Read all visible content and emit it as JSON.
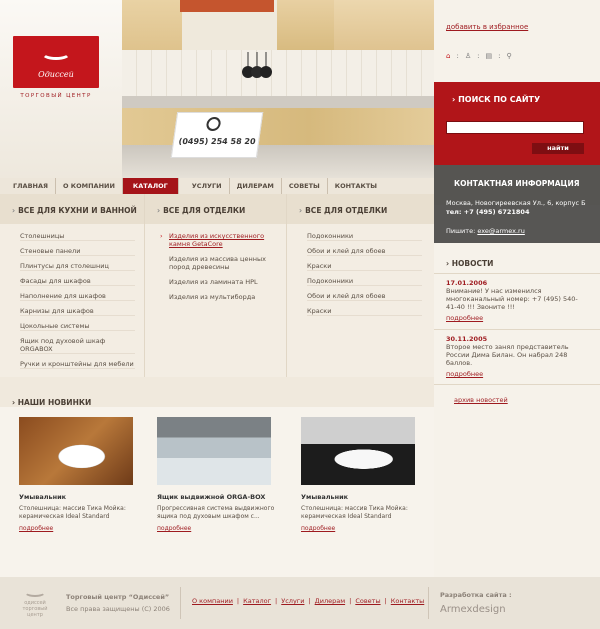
{
  "brand": {
    "name": "Одиссей",
    "tagline": "ТОРГОВЫЙ ЦЕНТР"
  },
  "phone": "(0495) 254 58 20",
  "favorites_link": "добавить в избранное",
  "top_icons": [
    "home-icon",
    "sitemap-icon",
    "bookmark-icon",
    "search-icon"
  ],
  "search": {
    "title": "ПОИСК ПО САЙТУ",
    "button": "найти",
    "placeholder": ""
  },
  "nav": [
    "ГЛАВНАЯ",
    "О КОМПАНИИ",
    "КАТАЛОГ",
    "УСЛУГИ",
    "ДИЛЕРАМ",
    "СОВЕТЫ",
    "КОНТАКТЫ"
  ],
  "nav_active": "КАТАЛОГ",
  "columns": [
    {
      "title": "ВСЕ ДЛЯ КУХНИ И ВАННОЙ",
      "items": [
        "Столешницы",
        "Стеновые панели",
        "Плинтусы для столешниц",
        "Фасады для шкафов",
        "Наполнение для шкафов",
        "Карнизы для шкафов",
        "Цокольные системы",
        "Ящик под духовой шкаф ORGABOX",
        "Ручки и кронштейны для мебели"
      ]
    },
    {
      "title": "ВСЕ ДЛЯ ОТДЕЛКИ",
      "items": [
        "Изделия из искусственного камня GetaCore",
        "Изделия из массива ценных пород древесины",
        "Изделия из ламината HPL",
        "Изделия из мультиборда"
      ]
    },
    {
      "title": "ВСЕ ДЛЯ ОТДЕЛКИ",
      "items": [
        "Подоконники",
        "Обои и клей для обоев",
        "Краски",
        "Подоконники",
        "Обои и клей для обоев",
        "Краски"
      ]
    }
  ],
  "contact": {
    "title": "КОНТАКТНАЯ ИНФОРМАЦИЯ",
    "address": "Москва, Новогиреевская Ул., 6, корпус Б",
    "phone": "тел: +7 (495) 6721804",
    "write_label": "Пишите:",
    "email": "exe@armex.ru"
  },
  "news": {
    "title": "НОВОСТИ",
    "items": [
      {
        "date": "17.01.2006",
        "text": "Внимание! У нас изменился многоканальный номер: +7 (495) 540-41-40 !!! Звоните !!!",
        "more": "подробнее"
      },
      {
        "date": "30.11.2005",
        "text": "Второе место занял представитель России Дима Билан. Он набрал 248 баллов.",
        "more": "подробнее"
      }
    ],
    "archive": "архив новостей"
  },
  "novelties": {
    "title": "НАШИ НОВИНКИ",
    "items": [
      {
        "title": "Умывальник",
        "desc": "Столешница: массив Тика Мойка: керамическая Ideal Standard",
        "more": "подробнее"
      },
      {
        "title": "Ящик выдвижной ORGA-BOX",
        "desc": "Прогрессивная система выдвижного ящика под духовым шкафом с...",
        "more": "подробнее"
      },
      {
        "title": "Умывальник",
        "desc": "Столешница: массив Тика Мойка: керамическая Ideal Standard",
        "more": "подробнее"
      }
    ]
  },
  "footer": {
    "company": "Торговый центр “Одиссей”",
    "rights": "Все права защищены (С) 2006",
    "links": [
      "О компании",
      "Каталог",
      "Услуги",
      "Дилерам",
      "Советы",
      "Контакты"
    ],
    "dev_label": "Разработка сайта :",
    "dev_name": "Armexdesign",
    "logo_name": "одиссей",
    "logo_sub": "торговый центр"
  }
}
